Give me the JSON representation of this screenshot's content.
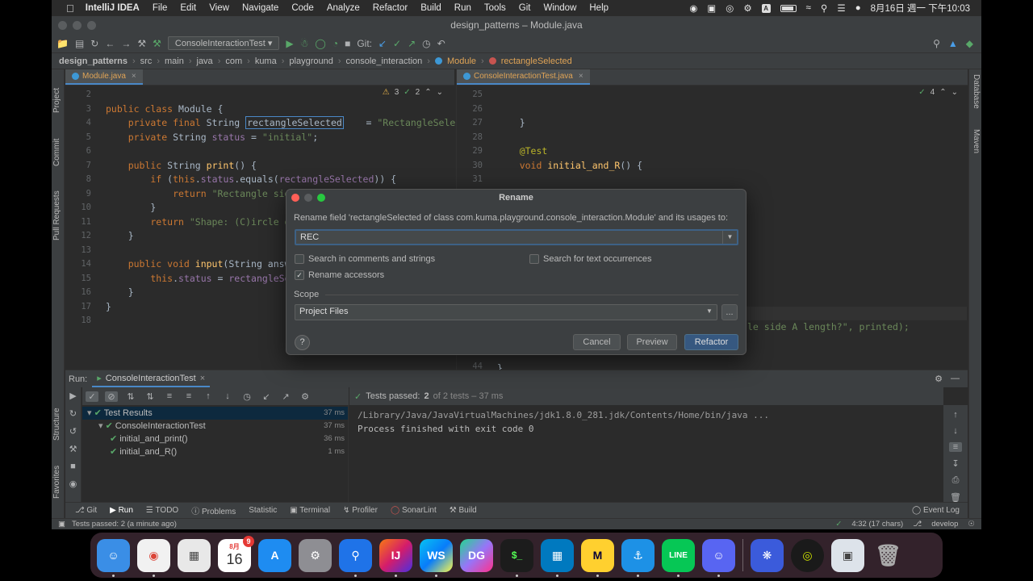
{
  "menubar": {
    "app": "IntelliJ IDEA",
    "items": [
      "File",
      "Edit",
      "View",
      "Navigate",
      "Code",
      "Analyze",
      "Refactor",
      "Build",
      "Run",
      "Tools",
      "Git",
      "Window",
      "Help"
    ],
    "datetime": "8月16日 週一 下午10:03",
    "input_indicator": "A"
  },
  "window": {
    "title": "design_patterns – Module.java"
  },
  "toolbar": {
    "run_config": "ConsoleInteractionTest",
    "git_label": "Git:"
  },
  "breadcrumbs": [
    "design_patterns",
    "src",
    "main",
    "java",
    "com",
    "kuma",
    "playground",
    "console_interaction",
    "Module",
    "rectangleSelected"
  ],
  "side_left": [
    "Project",
    "Commit",
    "Pull Requests",
    "Structure",
    "Favorites"
  ],
  "side_right": [
    "Database",
    "Maven"
  ],
  "editor_left": {
    "tab": "Module.java",
    "warnings": "3",
    "checks": "2",
    "lines": [
      {
        "n": "2",
        "html": ""
      },
      {
        "n": "3",
        "parts": [
          [
            "kw",
            "public class "
          ],
          [
            "plain",
            "Module {"
          ]
        ]
      },
      {
        "n": "4",
        "parts": [
          [
            "kw",
            "    private final "
          ],
          [
            "plain",
            "String "
          ],
          [
            "edit",
            "rectangleSelected"
          ],
          [
            "plain",
            "  "
          ],
          [
            "plain",
            "  = "
          ],
          [
            "str",
            "\"RectangleSelecte"
          ]
        ]
      },
      {
        "n": "5",
        "parts": [
          [
            "kw",
            "    private "
          ],
          [
            "plain",
            "String "
          ],
          [
            "fld",
            "status"
          ],
          [
            "plain",
            " = "
          ],
          [
            "str",
            "\"initial\""
          ],
          [
            "plain",
            ";"
          ]
        ]
      },
      {
        "n": "6",
        "parts": []
      },
      {
        "n": "7",
        "parts": [
          [
            "kw",
            "    public "
          ],
          [
            "plain",
            "String "
          ],
          [
            "fn",
            "print"
          ],
          [
            "plain",
            "() {"
          ]
        ]
      },
      {
        "n": "8",
        "parts": [
          [
            "kw",
            "        if "
          ],
          [
            "plain",
            "("
          ],
          [
            "kw",
            "this"
          ],
          [
            "plain",
            "."
          ],
          [
            "fld",
            "status"
          ],
          [
            "plain",
            ".equals("
          ],
          [
            "fld",
            "rectangleSelected"
          ],
          [
            "plain",
            ")) {"
          ]
        ]
      },
      {
        "n": "9",
        "parts": [
          [
            "kw",
            "            return "
          ],
          [
            "str",
            "\"Rectangle side "
          ]
        ]
      },
      {
        "n": "10",
        "parts": [
          [
            "plain",
            "        }"
          ]
        ]
      },
      {
        "n": "11",
        "parts": [
          [
            "kw",
            "        return "
          ],
          [
            "str",
            "\"Shape: (C)ircle or"
          ]
        ]
      },
      {
        "n": "12",
        "parts": [
          [
            "plain",
            "    }"
          ]
        ]
      },
      {
        "n": "13",
        "parts": []
      },
      {
        "n": "14",
        "parts": [
          [
            "kw",
            "    public void "
          ],
          [
            "fn",
            "input"
          ],
          [
            "plain",
            "(String "
          ],
          [
            "plain",
            "answer"
          ]
        ]
      },
      {
        "n": "15",
        "parts": [
          [
            "kw",
            "        this"
          ],
          [
            "plain",
            "."
          ],
          [
            "fld",
            "status"
          ],
          [
            "plain",
            " = "
          ],
          [
            "fld",
            "rectangleSele"
          ]
        ]
      },
      {
        "n": "16",
        "parts": [
          [
            "plain",
            "    }"
          ]
        ]
      },
      {
        "n": "17",
        "parts": [
          [
            "plain",
            "}"
          ]
        ]
      },
      {
        "n": "18",
        "parts": []
      }
    ]
  },
  "editor_right": {
    "tab": "ConsoleInteractionTest.java",
    "checks": "4",
    "lines": [
      {
        "n": "25",
        "parts": []
      },
      {
        "n": "26",
        "parts": []
      },
      {
        "n": "27",
        "parts": [
          [
            "plain",
            "    }"
          ]
        ]
      },
      {
        "n": "28",
        "parts": []
      },
      {
        "n": "29",
        "parts": [
          [
            "ann",
            "    @Test"
          ]
        ]
      },
      {
        "n": "30",
        "parts": [
          [
            "kw",
            "    void "
          ],
          [
            "fn",
            "initial_and_R"
          ],
          [
            "plain",
            "() {"
          ]
        ]
      },
      {
        "n": "31",
        "parts": []
      }
    ],
    "fragment": "le side A length?\", printed);",
    "fragment_line": "",
    "last_line_number": "44",
    "last_line": "}"
  },
  "dialog": {
    "title": "Rename",
    "description": "Rename field 'rectangleSelected of class com.kuma.playground.console_interaction.Module' and its usages to:",
    "input_value": "REC",
    "options": [
      {
        "label": "Search in comments and strings",
        "checked": false
      },
      {
        "label": "Search for text occurrences",
        "checked": false
      },
      {
        "label": "Rename accessors",
        "checked": true
      }
    ],
    "scope_label": "Scope",
    "scope_value": "Project Files",
    "more_button": "...",
    "help": "?",
    "cancel": "Cancel",
    "preview": "Preview",
    "refactor": "Refactor"
  },
  "run": {
    "label": "Run:",
    "tab": "ConsoleInteractionTest",
    "status_prefix": "Tests passed:",
    "passed": "2",
    "status_suffix": "of 2 tests – 37 ms",
    "tree": [
      {
        "label": "Test Results",
        "time": "37 ms",
        "indent": 0
      },
      {
        "label": "ConsoleInteractionTest",
        "time": "37 ms",
        "indent": 1
      },
      {
        "label": "initial_and_print()",
        "time": "36 ms",
        "indent": 2
      },
      {
        "label": "initial_and_R()",
        "time": "1 ms",
        "indent": 2
      }
    ],
    "console": [
      "/Library/Java/JavaVirtualMachines/jdk1.8.0_281.jdk/Contents/Home/bin/java ...",
      "",
      "Process finished with exit code 0"
    ]
  },
  "bottom_tabs": [
    "Git",
    "Run",
    "TODO",
    "Problems",
    "Statistic",
    "Terminal",
    "Profiler",
    "SonarLint",
    "Build"
  ],
  "event_log": "Event Log",
  "status": {
    "left": "Tests passed: 2 (a minute ago)",
    "position": "4:32 (17 chars)",
    "branch": "develop"
  },
  "dock": {
    "calendar_month": "8月",
    "calendar_day": "16",
    "calendar_badge": "9",
    "labels": [
      "IJ",
      "WS",
      "DG"
    ]
  }
}
